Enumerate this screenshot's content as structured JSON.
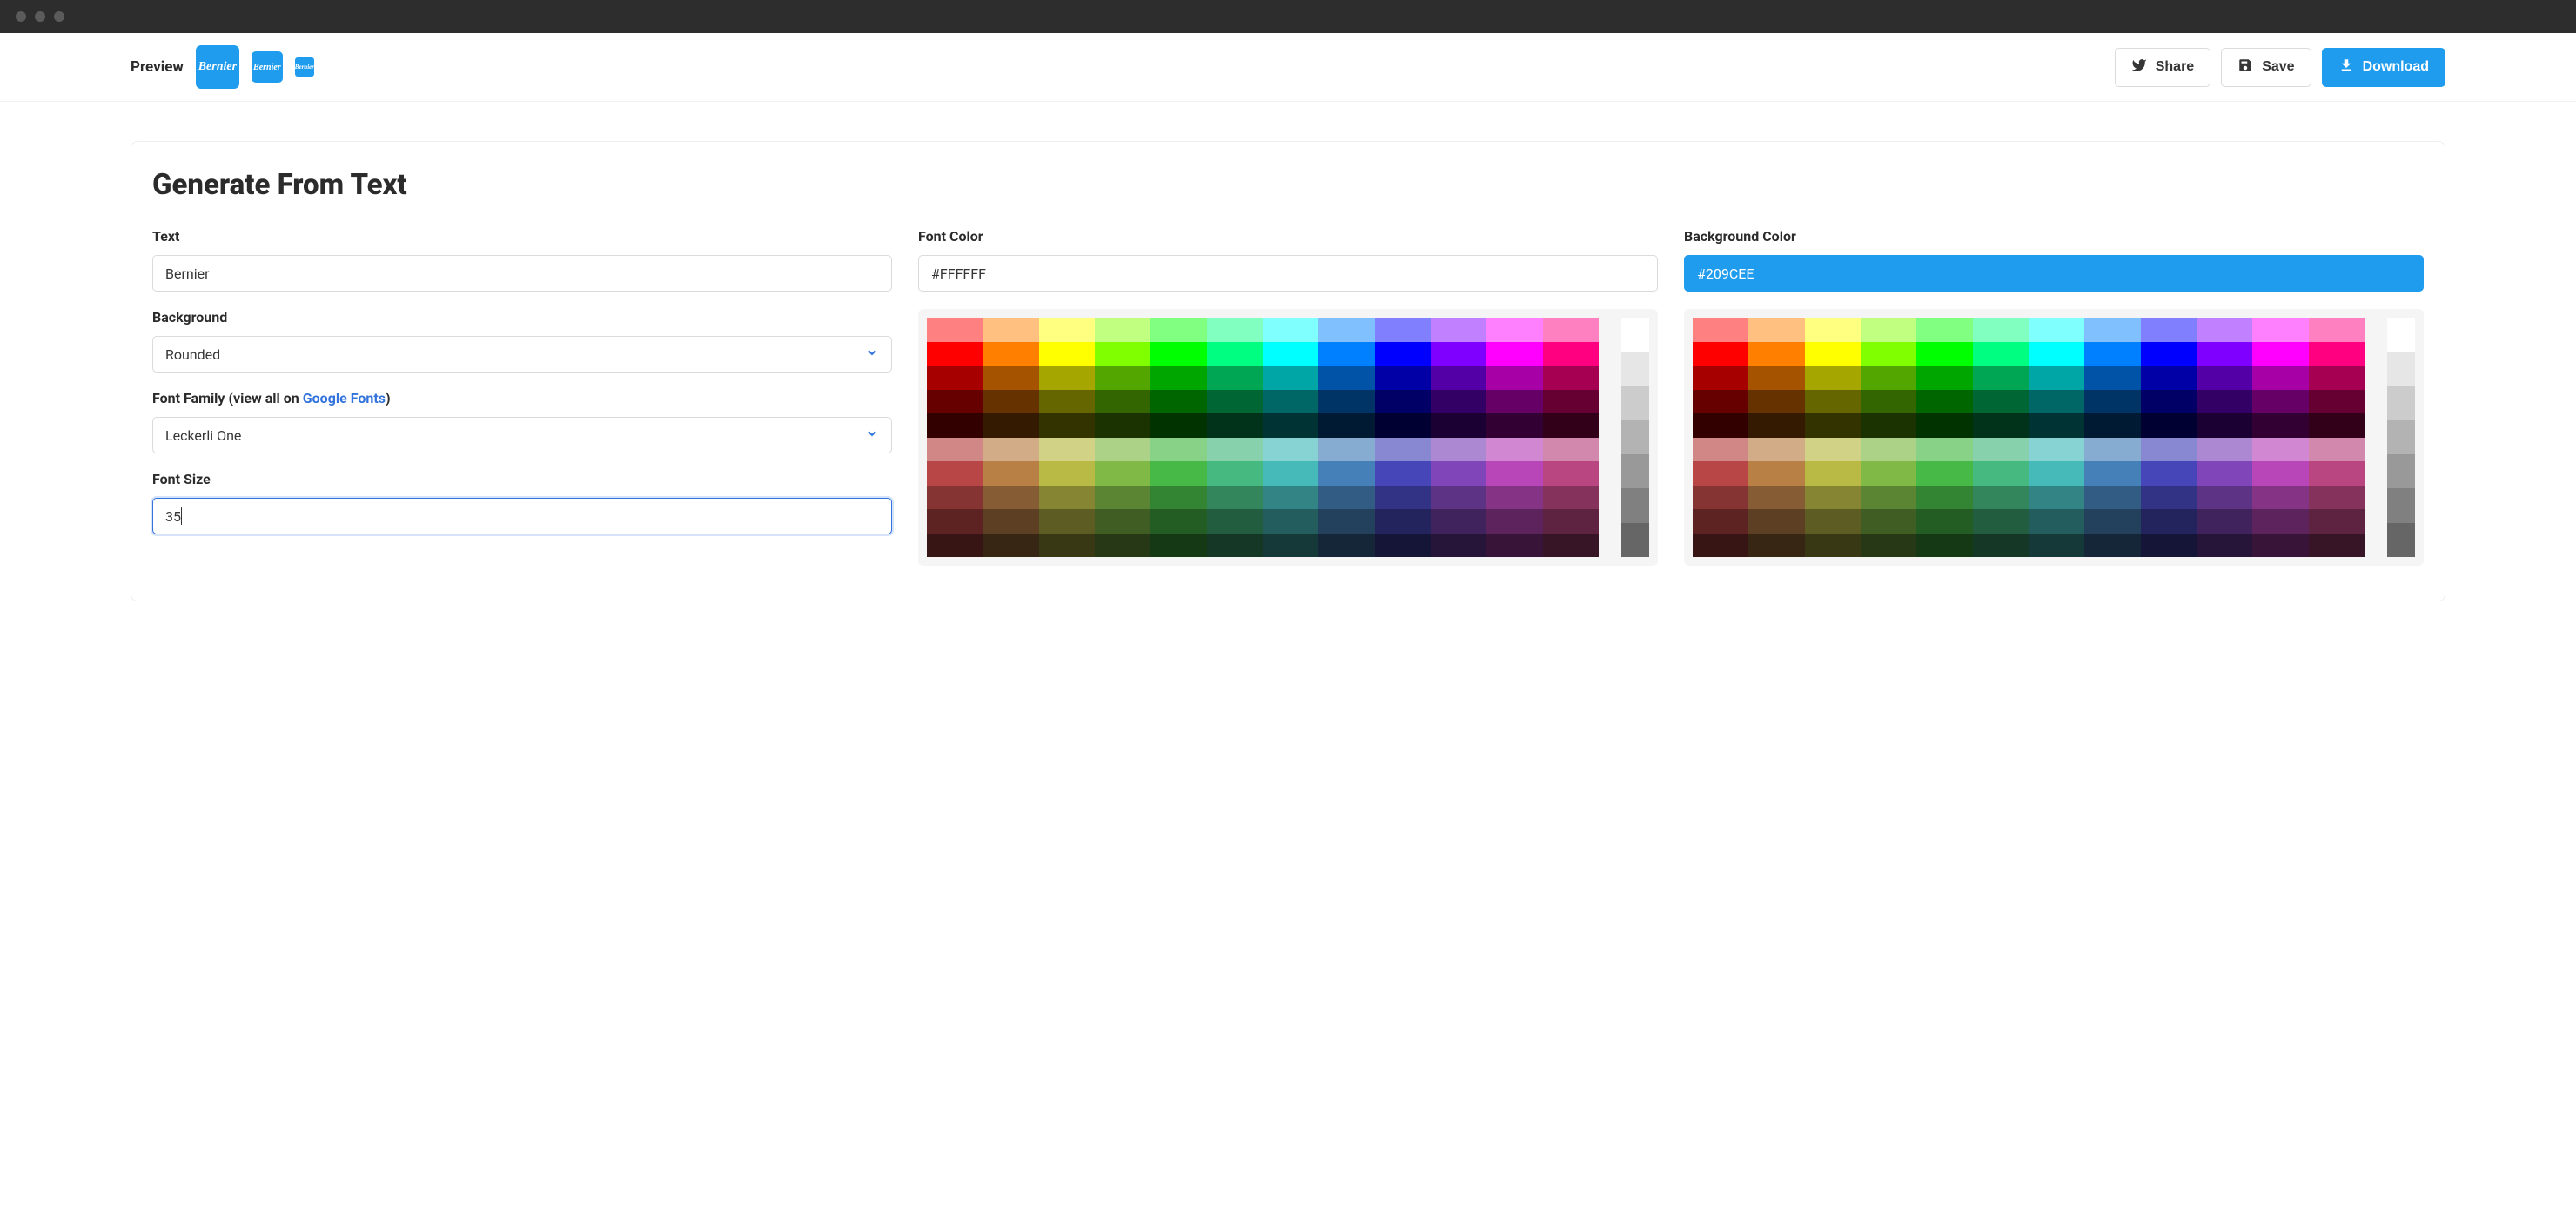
{
  "topbar": {
    "preview_label": "Preview",
    "thumb_text": "Bernier",
    "share_label": "Share",
    "save_label": "Save",
    "download_label": "Download"
  },
  "card": {
    "title": "Generate From Text"
  },
  "form": {
    "text_label": "Text",
    "text_value": "Bernier",
    "background_label": "Background",
    "background_value": "Rounded",
    "font_family_label_prefix": "Font Family (view all on ",
    "font_family_link": "Google Fonts",
    "font_family_label_suffix": ")",
    "font_family_value": "Leckerli One",
    "font_size_label": "Font Size",
    "font_size_value": "35"
  },
  "font_color": {
    "label": "Font Color",
    "value": "#FFFFFF"
  },
  "bg_color": {
    "label": "Background Color",
    "value": "#209CEE"
  },
  "palette": {
    "hues": [
      "#ff7f7f",
      "#ffbf7f",
      "#ffff7f",
      "#bfff7f",
      "#7fff7f",
      "#7fffbf",
      "#7fffff",
      "#7fbfff",
      "#7f7fff",
      "#bf7fff",
      "#ff7fff",
      "#ff7fbf"
    ],
    "shade_factors_top": [
      1.0,
      0.75,
      0.5,
      0.25
    ],
    "light_mix_top": [
      0.5,
      0.375,
      0.25,
      0.125
    ],
    "mid_factors": [
      1.0,
      0.8,
      0.6,
      0.4,
      0.25
    ],
    "grays": [
      "#ffffff",
      "#e6e6e6",
      "#cccccc",
      "#b3b3b3",
      "#999999",
      "#808080",
      "#666666",
      "#4d4d4d",
      "#333333",
      "#1a1a1a",
      "#000000"
    ]
  },
  "colors": {
    "accent": "#209cee",
    "link": "#3273dc"
  }
}
